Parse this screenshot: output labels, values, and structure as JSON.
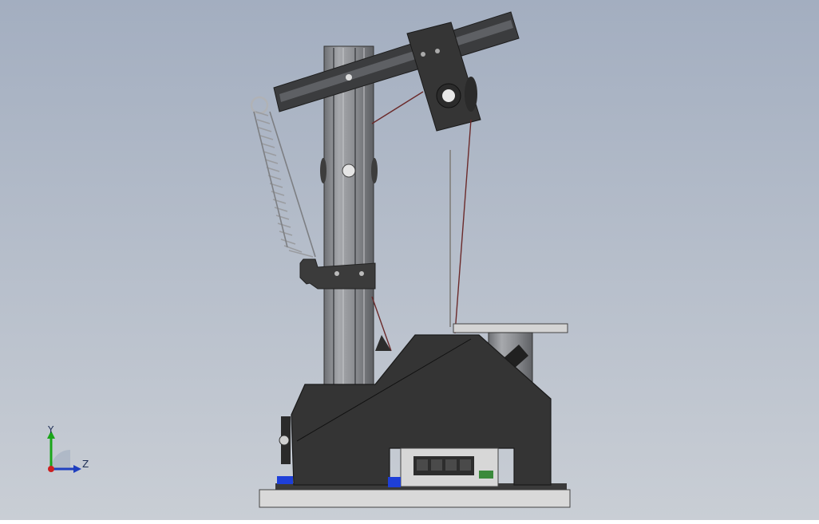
{
  "viewport": {
    "background_top": "#a3aec0",
    "background_bottom": "#c7ccd3",
    "model": "mechanical-assembly-side-view"
  },
  "triad": {
    "y_label": "Y",
    "z_label": "Z",
    "y_color": "#1aa51a",
    "z_color": "#1f3fbf",
    "x_color": "#cc2020"
  },
  "colors": {
    "frame": "#2f2f2f",
    "profile": "#8e9093",
    "profile_dark": "#5d5f63",
    "plate": "#d6d6d6",
    "accent_blue": "#1e3fd8"
  }
}
